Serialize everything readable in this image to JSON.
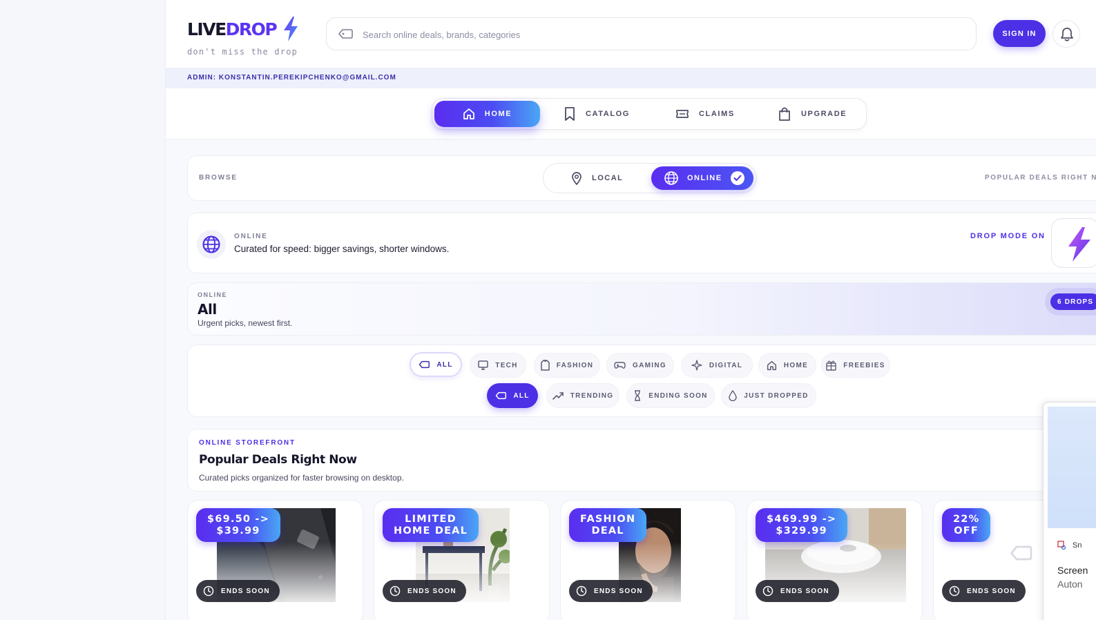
{
  "brand": {
    "name_part1": "LIVE",
    "name_part2": "DROP",
    "tagline": "don't miss the drop"
  },
  "search": {
    "placeholder": "Search online deals, brands, categories",
    "icon": "tag-icon"
  },
  "header": {
    "signin_label": "SIGN IN",
    "bell_icon": "bell-icon"
  },
  "admin": {
    "text": "ADMIN: KONSTANTIN.PEREKIPCHENKO@GMAIL.COM"
  },
  "nav": {
    "items": [
      {
        "label": "HOME",
        "icon": "home-icon",
        "active": true
      },
      {
        "label": "CATALOG",
        "icon": "bookmark-icon",
        "active": false
      },
      {
        "label": "CLAIMS",
        "icon": "ticket-icon",
        "active": false
      },
      {
        "label": "UPGRADE",
        "icon": "shopping-bag-icon",
        "active": false
      }
    ]
  },
  "browse": {
    "label": "BROWSE",
    "options": [
      {
        "label": "LOCAL",
        "icon": "map-pin-icon",
        "active": false
      },
      {
        "label": "ONLINE",
        "icon": "globe-icon",
        "active": true
      }
    ],
    "right_text": "POPULAR DEALS RIGHT N"
  },
  "mode": {
    "kicker": "ONLINE",
    "description": "Curated for speed: bigger savings, shorter windows.",
    "drop_mode_label": "DROP MODE ON"
  },
  "category_banner": {
    "kicker": "ONLINE",
    "title": "All",
    "subtitle": "Urgent picks, newest first.",
    "drops_count": "6 DROPS"
  },
  "filters": {
    "categories": [
      {
        "label": "ALL",
        "icon": "tag-icon",
        "selected": true
      },
      {
        "label": "TECH",
        "icon": "monitor-icon",
        "selected": false
      },
      {
        "label": "FASHION",
        "icon": "shirt-icon",
        "selected": false
      },
      {
        "label": "GAMING",
        "icon": "gamepad-icon",
        "selected": false
      },
      {
        "label": "DIGITAL",
        "icon": "sparkle-icon",
        "selected": false
      },
      {
        "label": "HOME",
        "icon": "home-icon",
        "selected": false
      },
      {
        "label": "FREEBIES",
        "icon": "gift-icon",
        "selected": false
      }
    ],
    "sorts": [
      {
        "label": "ALL",
        "icon": "tag-icon",
        "selected": true
      },
      {
        "label": "TRENDING",
        "icon": "trending-up-icon",
        "selected": false
      },
      {
        "label": "ENDING SOON",
        "icon": "hourglass-icon",
        "selected": false
      },
      {
        "label": "JUST DROPPED",
        "icon": "droplet-icon",
        "selected": false
      }
    ]
  },
  "storefront": {
    "kicker": "ONLINE STOREFRONT",
    "title": "Popular Deals Right Now",
    "subtitle": "Curated picks organized for faster browsing on desktop."
  },
  "deals": [
    {
      "badge": "$69.50 ->\n$39.99",
      "status": "ENDS SOON",
      "image": "dark-jacket-photo"
    },
    {
      "badge": "LIMITED\nHOME DEAL",
      "status": "ENDS SOON",
      "image": "console-table-photo"
    },
    {
      "badge": "FASHION\nDEAL",
      "status": "ENDS SOON",
      "image": "bearded-man-photo"
    },
    {
      "badge": "$469.99 ->\n$329.99",
      "status": "ENDS SOON",
      "image": "robot-vacuum-photo"
    },
    {
      "badge": "22%\nOFF",
      "status": "ENDS SOON",
      "image": "placeholder-tag-icon"
    }
  ],
  "popup": {
    "app_name": "Sn",
    "line1": "Screen",
    "line2": "Auton"
  },
  "colors": {
    "accent": "#4b30e6",
    "accent_gradient_end": "#4aa6f5",
    "text": "#16162a",
    "muted": "#7d7f96"
  }
}
